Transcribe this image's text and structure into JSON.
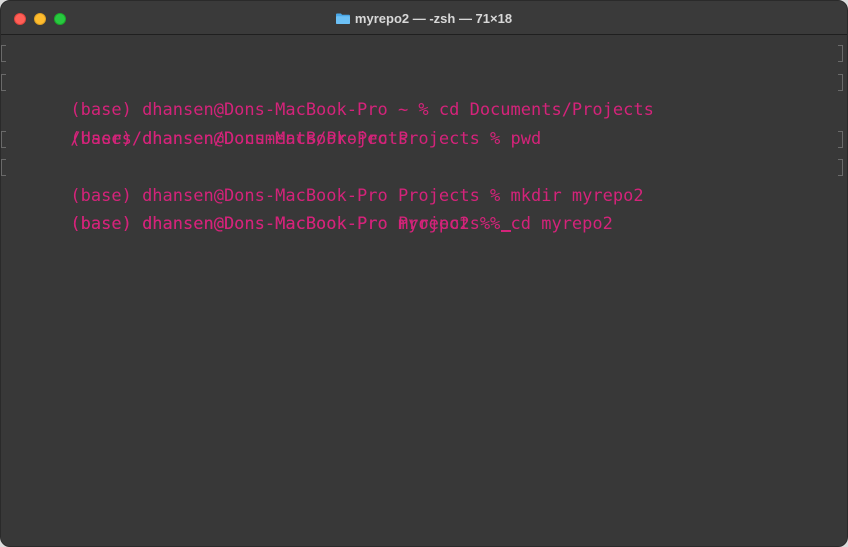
{
  "window": {
    "title": "myrepo2 — -zsh — 71×18"
  },
  "terminal": {
    "text_color": "#d4237a",
    "background": "#383838",
    "lines": [
      {
        "text": "(base) dhansen@Dons-MacBook-Pro ~ % cd Documents/Projects",
        "marked": true
      },
      {
        "text": "(base) dhansen@Dons-MacBook-Pro Projects % pwd",
        "marked": true
      },
      {
        "text": "/Users/dhansen/Documents/Projects",
        "marked": false
      },
      {
        "text": "(base) dhansen@Dons-MacBook-Pro Projects % mkdir myrepo2",
        "marked": true
      },
      {
        "text": "(base) dhansen@Dons-MacBook-Pro Projects % cd myrepo2",
        "marked": true
      },
      {
        "text": "(base) dhansen@Dons-MacBook-Pro myrepo2 % ",
        "marked": false
      }
    ]
  }
}
